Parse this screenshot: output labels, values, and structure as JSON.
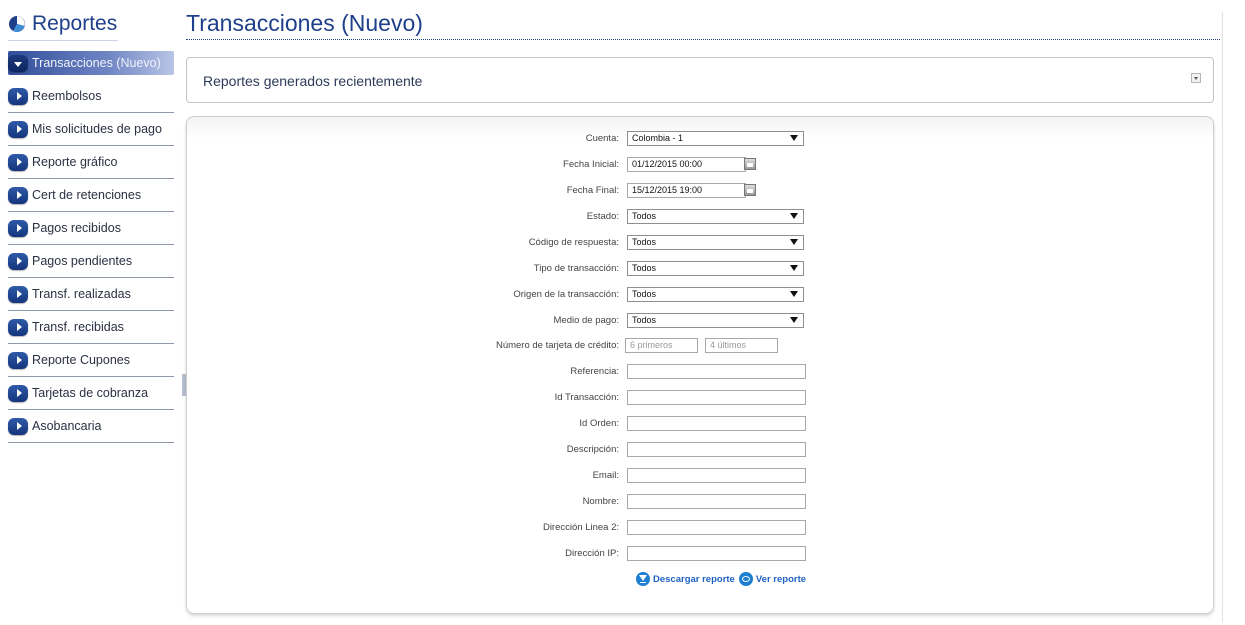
{
  "sidebar": {
    "title": "Reportes",
    "items": [
      {
        "label": "Transacciones (Nuevo)"
      },
      {
        "label": "Reembolsos"
      },
      {
        "label": "Mis solicitudes de pago"
      },
      {
        "label": "Reporte gráfico"
      },
      {
        "label": "Cert de retenciones"
      },
      {
        "label": "Pagos recibidos"
      },
      {
        "label": "Pagos pendientes"
      },
      {
        "label": "Transf. realizadas"
      },
      {
        "label": "Transf. recibidas"
      },
      {
        "label": "Reporte Cupones"
      },
      {
        "label": "Tarjetas de cobranza"
      },
      {
        "label": "Asobancaria"
      }
    ]
  },
  "main": {
    "title": "Transacciones (Nuevo)",
    "recent_label": "Reportes generados recientemente"
  },
  "form": {
    "cuenta": {
      "label": "Cuenta:",
      "value": "Colombia - 1"
    },
    "fecha_inicial": {
      "label": "Fecha Inicial:",
      "value": "01/12/2015 00:00"
    },
    "fecha_final": {
      "label": "Fecha Final:",
      "value": "15/12/2015 19:00"
    },
    "estado": {
      "label": "Estado:",
      "value": "Todos"
    },
    "codigo": {
      "label": "Código de respuesta:",
      "value": "Todos"
    },
    "tipo": {
      "label": "Tipo de transacción:",
      "value": "Todos"
    },
    "origen": {
      "label": "Origen de la transacción:",
      "value": "Todos"
    },
    "medio": {
      "label": "Medio de pago:",
      "value": "Todos"
    },
    "tarjeta": {
      "label": "Número de tarjeta de crédito:",
      "first_placeholder": "6 primeros",
      "last_placeholder": "4 últimos"
    },
    "referencia": {
      "label": "Referencia:"
    },
    "id_transaccion": {
      "label": "Id Transacción:"
    },
    "id_orden": {
      "label": "Id Orden:"
    },
    "descripcion": {
      "label": "Descripción:"
    },
    "email": {
      "label": "Email:"
    },
    "nombre": {
      "label": "Nombre:"
    },
    "direccion2": {
      "label": "Dirección Linea 2:"
    },
    "direccion_ip": {
      "label": "Dirección IP:"
    },
    "download_label": "Descargar reporte",
    "view_label": "Ver reporte"
  }
}
